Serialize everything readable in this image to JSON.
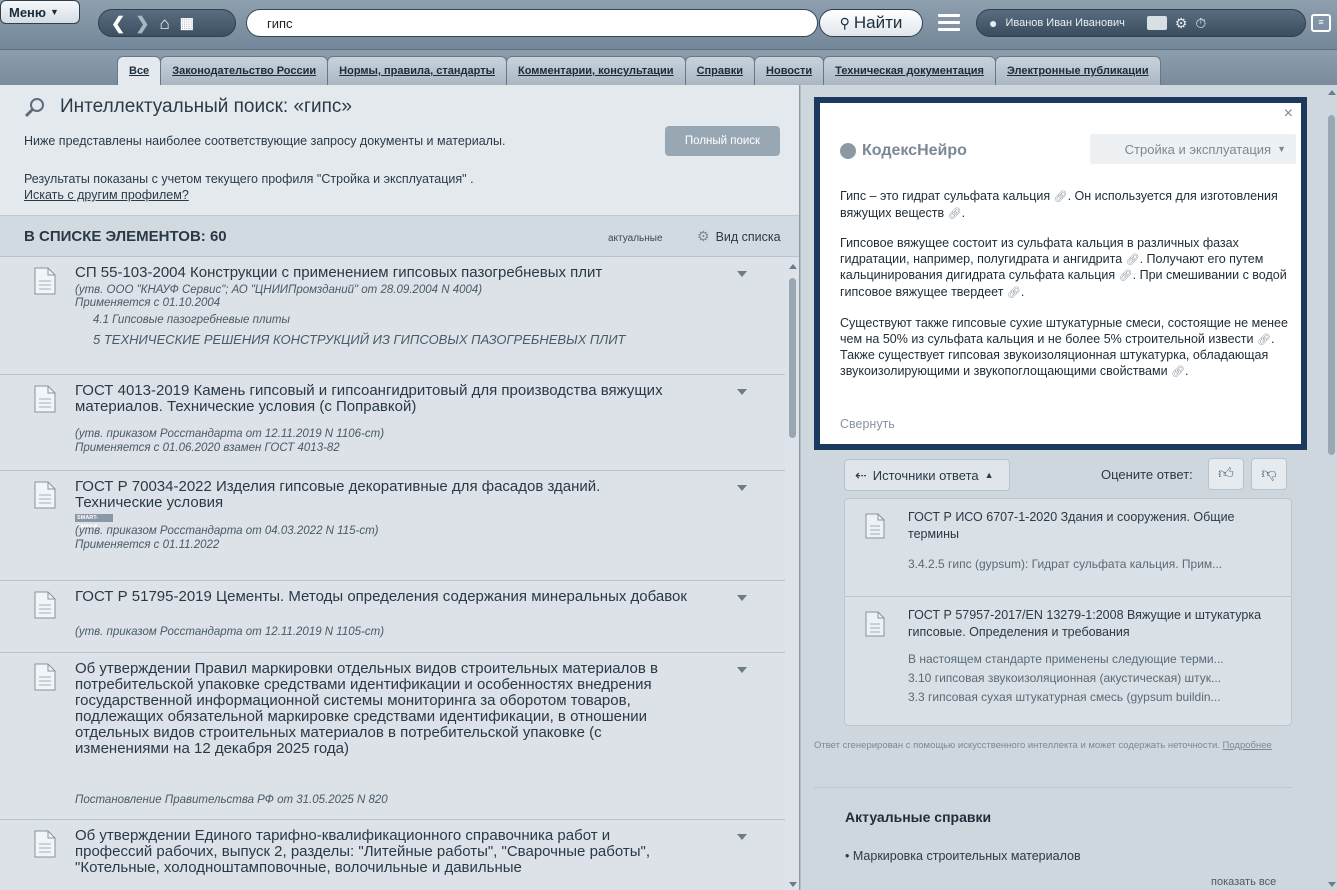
{
  "topbar": {
    "menu_label": "Меню",
    "search_value": "гипс",
    "find_label": "Найти",
    "user_name": "Иванов Иван Иванович"
  },
  "tabs": [
    {
      "label": "Все",
      "active": true
    },
    {
      "label": "Законодательство России"
    },
    {
      "label": "Нормы, правила, стандарты"
    },
    {
      "label": "Комментарии, консультации"
    },
    {
      "label": "Справки"
    },
    {
      "label": "Новости"
    },
    {
      "label": "Техническая документация"
    },
    {
      "label": "Электронные публикации"
    }
  ],
  "search": {
    "title": "Интеллектуальный поиск: «гипс»",
    "desc1": "Ниже представлены наиболее соответствующие запросу документы и материалы.",
    "desc2": "Результаты показаны с учетом текущего профиля \"Стройка и эксплуатация\" .",
    "other_profile": "Искать с другим профилем?",
    "full_search": "Полный поиск"
  },
  "list": {
    "count_label": "В СПИСКЕ ЭЛЕМЕНТОВ: 60",
    "actual_label": "актуальные",
    "view_label": "Вид списка",
    "docs": [
      {
        "title": "СП 55-103-2004 Конструкции с применением гипсовых пазогребневых плит",
        "meta": [
          "(утв. ООО \"КНАУФ Сервис\"; АО \"ЦНИИПромзданий\" от 28.09.2004 N 4004)",
          "Применяется с 01.10.2004"
        ],
        "sub": [
          "4.1 Гипсовые пазогребневые плиты",
          "5 ТЕХНИЧЕСКИЕ РЕШЕНИЯ КОНСТРУКЦИЙ ИЗ ГИПСОВЫХ ПАЗОГРЕБНЕВЫХ ПЛИТ"
        ]
      },
      {
        "title": "ГОСТ 4013-2019 Камень гипсовый и гипсоангидритовый для производства вяжущих материалов. Технические условия (с Поправкой)",
        "meta": [
          "(утв. приказом Росстандарта от 12.11.2019 N 1106-ст)",
          "Применяется с 01.06.2020 взамен ГОСТ 4013-82"
        ]
      },
      {
        "title": "ГОСТ Р 70034-2022 Изделия гипсовые декоративные для фасадов зданий. Технические условия",
        "badge": "SMART-данные",
        "meta": [
          "(утв. приказом Росстандарта от 04.03.2022 N 115-ст)",
          "Применяется с 01.11.2022"
        ]
      },
      {
        "title": "ГОСТ Р 51795-2019 Цементы. Методы определения содержания минеральных добавок",
        "meta": [
          "(утв. приказом Росстандарта от 12.11.2019 N 1105-ст)"
        ]
      },
      {
        "title": "Об утверждении Правил маркировки отдельных видов строительных материалов в потребительской упаковке средствами идентификации и особенностях внедрения государственной информационной системы мониторинга за оборотом товаров, подлежащих обязательной маркировке средствами идентификации, в отношении отдельных видов строительных материалов в потребительской упаковке (с изменениями на 12 декабря 2025 года)",
        "meta": [
          "Постановление Правительства РФ от 31.05.2025 N 820"
        ]
      },
      {
        "title": "Об утверждении Единого тарифно-квалификационного справочника работ и профессий рабочих, выпуск 2, разделы: \"Литейные работы\", \"Сварочные работы\", \"Котельные, холодноштамповочные, волочильные и давильные",
        "meta": []
      }
    ]
  },
  "ai": {
    "close_label": "×",
    "brand": "КодексНейро",
    "profile": "Стройка и эксплуатация",
    "p1": [
      "Гипс – это гидрат сульфата кальция",
      ". Он используется для изготовления вяжущих веществ",
      "."
    ],
    "p2": [
      "Гипсовое вяжущее состоит из сульфата кальция в различных фазах гидратации, например, полугидрата и ангидрита",
      ". Получают его путем кальцинирования дигидрата сульфата кальция",
      ". При смешивании с водой гипсовое вяжущее твердеет",
      "."
    ],
    "p3": [
      "Существуют также гипсовые сухие штукатурные смеси, состоящие не менее чем на 50% из сульфата кальция и не более 5% строительной извести",
      ". Также существует гипсовая звукоизоляционная штукатурка, обладающая звукоизолирующими и звукопоглощающими свойствами",
      "."
    ],
    "collapse": "Свернуть"
  },
  "sources": {
    "toggle_label": "Источники ответа",
    "rate_label": "Оцените ответ:",
    "items": [
      {
        "title": "ГОСТ Р ИСО 6707-1-2020 Здания и сооружения. Общие термины",
        "lines": [
          "3.4.2.5 гипс (gypsum): Гидрат сульфата кальция. Прим..."
        ]
      },
      {
        "title": "ГОСТ Р 57957-2017/EN 13279-1:2008 Вяжущие и штукатурка гипсовые. Определения и требования",
        "lines": [
          "В настоящем стандарте применены следующие терми...",
          "3.10 гипсовая звукоизоляционная (акустическая) штук...",
          "3.3 гипсовая сухая штукатурная смесь (gypsum buildin..."
        ]
      }
    ]
  },
  "disclaimer": {
    "text": "Ответ сгенерирован с помощью искусственного интеллекта и может содержать неточности.",
    "link": "Подробнее"
  },
  "actual": {
    "heading": "Актуальные справки",
    "item": "Маркировка строительных материалов",
    "show_all": "показать все"
  }
}
